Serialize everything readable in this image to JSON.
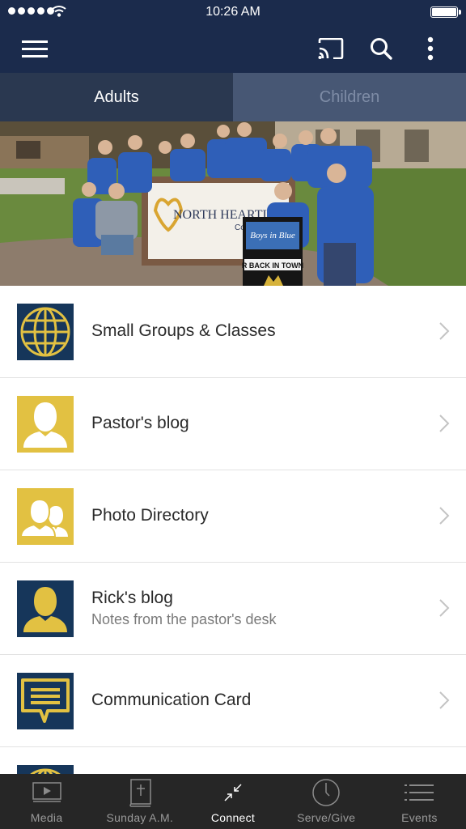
{
  "status_bar": {
    "time": "10:26 AM",
    "signal_icon": "signal-dots-icon",
    "wifi_icon": "wifi-icon",
    "battery_icon": "battery-icon"
  },
  "app_bar": {
    "menu_icon": "hamburger-menu-icon",
    "cast_icon": "cast-icon",
    "search_icon": "search-icon",
    "more_icon": "more-vertical-icon"
  },
  "tabs": [
    {
      "label": "Adults",
      "active": true
    },
    {
      "label": "Children",
      "active": false
    }
  ],
  "hero": {
    "sign_text": "NORTH HEARTL",
    "sign_subtext": "Commun",
    "poster_title": "Boys in Blue",
    "poster_banner": "R BACK IN TOWN"
  },
  "items": [
    {
      "title": "Small Groups & Classes",
      "subtitle": "",
      "icon": "globe-icon",
      "icon_bg": "#16365a",
      "icon_fg": "#e2c142"
    },
    {
      "title": "Pastor's blog",
      "subtitle": "",
      "icon": "person-icon",
      "icon_bg": "#e2c142",
      "icon_fg": "#ffffff"
    },
    {
      "title": "Photo Directory",
      "subtitle": "",
      "icon": "people-icon",
      "icon_bg": "#e2c142",
      "icon_fg": "#ffffff"
    },
    {
      "title": "Rick's blog",
      "subtitle": "Notes from the pastor's desk",
      "icon": "person-icon",
      "icon_bg": "#16365a",
      "icon_fg": "#e2c142"
    },
    {
      "title": "Communication Card",
      "subtitle": "",
      "icon": "chat-card-icon",
      "icon_bg": "#16365a",
      "icon_fg": "#e2c142"
    }
  ],
  "tab_bar": [
    {
      "label": "Media",
      "icon": "video-player-icon",
      "active": false
    },
    {
      "label": "Sunday A.M.",
      "icon": "bible-icon",
      "active": false
    },
    {
      "label": "Connect",
      "icon": "connect-arrows-icon",
      "active": true
    },
    {
      "label": "Serve/Give",
      "icon": "clock-icon",
      "active": false
    },
    {
      "label": "Events",
      "icon": "list-icon",
      "active": false
    }
  ],
  "colors": {
    "header_bg": "#1b2b4c",
    "tab_active_bg": "#2a3850",
    "tab_inactive_bg": "#475774",
    "navy": "#16365a",
    "gold": "#e2c142",
    "tab_bar_bg": "#262626"
  }
}
